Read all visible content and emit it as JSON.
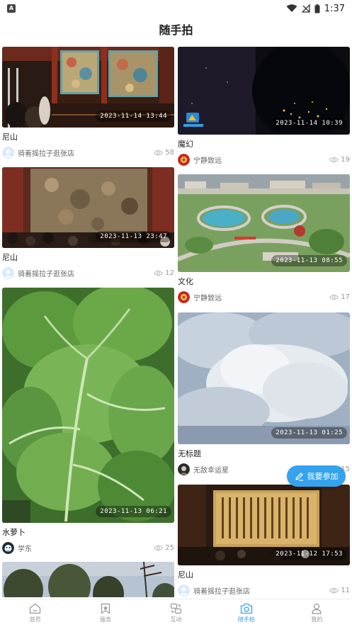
{
  "status_bar": {
    "badge": "A",
    "time": "1:37"
  },
  "header": {
    "title": "随手拍"
  },
  "colors": {
    "accent": "#35a2ee",
    "text_muted": "#999999"
  },
  "feed": {
    "left": [
      {
        "title": "尼山",
        "date": "2023-11-14  13:44",
        "author": "骑着摇拉子逛张店",
        "views": "58",
        "image": "museum-mural-crowd",
        "avatar": "light-blue"
      },
      {
        "title": "尼山",
        "date": "2023-11-13  23:47",
        "author": "骑着摇拉子逛张店",
        "views": "12",
        "image": "painting-room",
        "avatar": "light-blue"
      },
      {
        "title": "水萝卜",
        "date": "2023-11-13  06:21",
        "author": "学东",
        "views": "25",
        "image": "cabbage",
        "avatar": "cartoon"
      },
      {
        "title": "",
        "date": "",
        "author": "",
        "views": "",
        "image": "trees-sky",
        "avatar": ""
      }
    ],
    "right": [
      {
        "title": "魔幻",
        "date": "2023-11-14  10:39",
        "author": "宁静致远",
        "views": "19",
        "image": "night-city",
        "avatar": "red-flower"
      },
      {
        "title": "文化",
        "date": "2023-11-13  08:55",
        "author": "宁静致远",
        "views": "17",
        "image": "park-aerial",
        "avatar": "red-flower"
      },
      {
        "title": "无标题",
        "date": "2023-11-13  01:25",
        "author": "无敌幸运星",
        "views": "15",
        "image": "clouds",
        "avatar": "dark"
      },
      {
        "title": "尼山",
        "date": "2023-11-12  17:53",
        "author": "骑着摇拉子逛张店",
        "views": "11",
        "image": "calligraphy-hall",
        "avatar": "light-blue"
      }
    ]
  },
  "fab": {
    "label": "我要参加",
    "icon": "pencil-icon"
  },
  "bottom_nav": [
    {
      "label": "首页",
      "icon": "home-icon",
      "active": false
    },
    {
      "label": "服务",
      "icon": "bookmark-icon",
      "active": false
    },
    {
      "label": "互动",
      "icon": "interact-icon",
      "active": false
    },
    {
      "label": "随手拍",
      "icon": "camera-icon",
      "active": true
    },
    {
      "label": "我的",
      "icon": "user-icon",
      "active": false
    }
  ]
}
